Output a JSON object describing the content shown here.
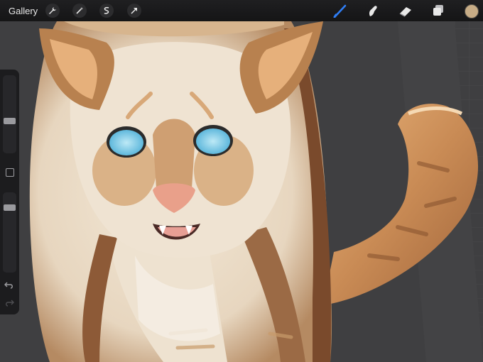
{
  "app": {
    "gallery_label": "Gallery",
    "accent_color": "#2f7ef6",
    "current_color": "#c7ac86"
  },
  "toolbar_left": [
    {
      "name": "actions",
      "icon": "wrench-icon"
    },
    {
      "name": "adjustments",
      "icon": "magic-wand-icon"
    },
    {
      "name": "selection",
      "icon": "selection-s-icon"
    },
    {
      "name": "transform",
      "icon": "arrow-cursor-icon"
    }
  ],
  "toolbar_right": [
    {
      "name": "brush",
      "icon": "brush-icon",
      "active": true
    },
    {
      "name": "smudge",
      "icon": "smudge-icon",
      "active": false
    },
    {
      "name": "eraser",
      "icon": "eraser-icon",
      "active": false
    },
    {
      "name": "layers",
      "icon": "layers-icon",
      "active": false
    },
    {
      "name": "colors",
      "icon": "color-swatch-icon",
      "active": false
    }
  ],
  "sidebar": {
    "brush_size_level": 0.45,
    "opacity_level": 0.18,
    "undo_icon": "undo-icon",
    "redo_icon": "redo-icon"
  },
  "canvas": {
    "artwork": "cat-painting-icon"
  }
}
